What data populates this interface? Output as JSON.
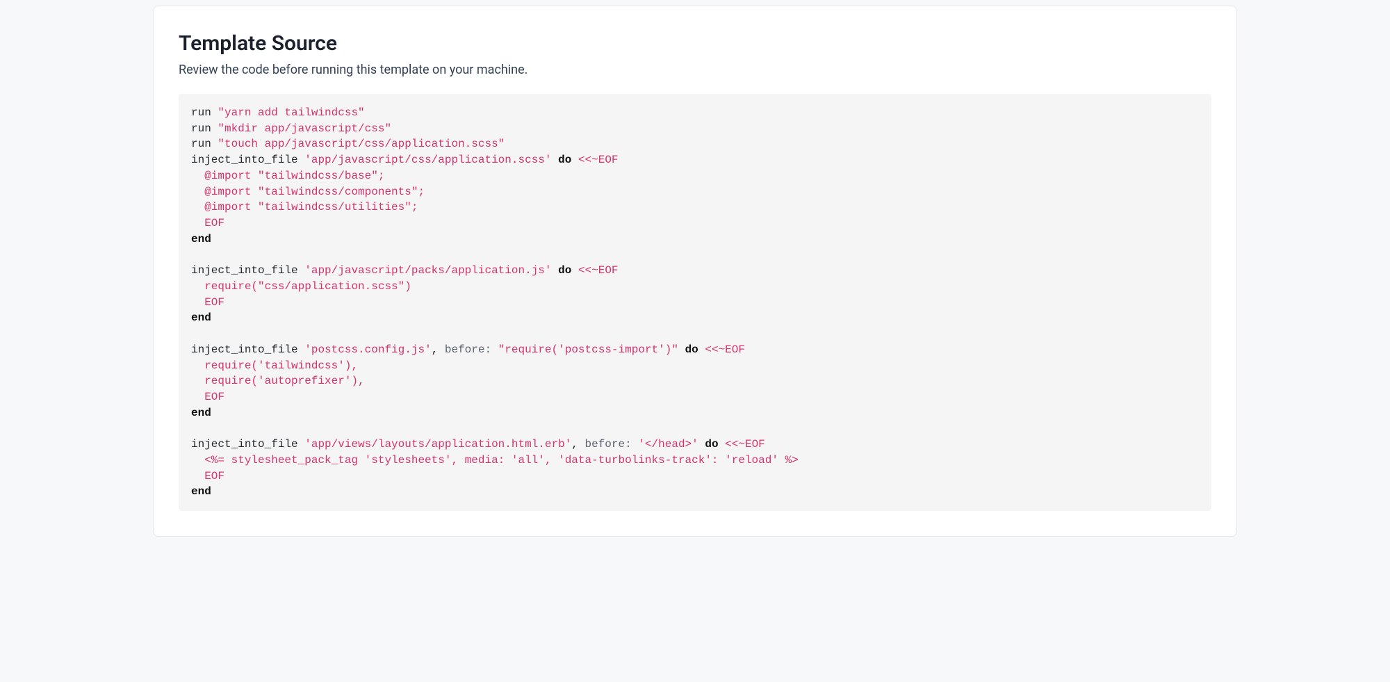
{
  "header": {
    "title": "Template Source",
    "subtitle": "Review the code before running this template on your machine."
  },
  "code": {
    "tokens": [
      [
        [
          "ident",
          "run "
        ],
        [
          "str",
          "\"yarn add tailwindcss\""
        ]
      ],
      [
        [
          "ident",
          "run "
        ],
        [
          "str",
          "\"mkdir app/javascript/css\""
        ]
      ],
      [
        [
          "ident",
          "run "
        ],
        [
          "str",
          "\"touch app/javascript/css/application.scss\""
        ]
      ],
      [
        [
          "ident",
          "inject_into_file "
        ],
        [
          "str",
          "'app/javascript/css/application.scss'"
        ],
        [
          "ident",
          " "
        ],
        [
          "kw",
          "do"
        ],
        [
          "ident",
          " "
        ],
        [
          "str",
          "<<~EOF"
        ]
      ],
      [
        [
          "str",
          "  @import \"tailwindcss/base\";"
        ]
      ],
      [
        [
          "str",
          "  @import \"tailwindcss/components\";"
        ]
      ],
      [
        [
          "str",
          "  @import \"tailwindcss/utilities\";"
        ]
      ],
      [
        [
          "str",
          "  EOF"
        ]
      ],
      [
        [
          "kw",
          "end"
        ]
      ],
      [],
      [
        [
          "ident",
          "inject_into_file "
        ],
        [
          "str",
          "'app/javascript/packs/application.js'"
        ],
        [
          "ident",
          " "
        ],
        [
          "kw",
          "do"
        ],
        [
          "ident",
          " "
        ],
        [
          "str",
          "<<~EOF"
        ]
      ],
      [
        [
          "str",
          "  require(\"css/application.scss\")"
        ]
      ],
      [
        [
          "str",
          "  EOF"
        ]
      ],
      [
        [
          "kw",
          "end"
        ]
      ],
      [],
      [
        [
          "ident",
          "inject_into_file "
        ],
        [
          "str",
          "'postcss.config.js'"
        ],
        [
          "ident",
          ", "
        ],
        [
          "sym",
          "before:"
        ],
        [
          "ident",
          " "
        ],
        [
          "str",
          "\"require('postcss-import')\""
        ],
        [
          "ident",
          " "
        ],
        [
          "kw",
          "do"
        ],
        [
          "ident",
          " "
        ],
        [
          "str",
          "<<~EOF"
        ]
      ],
      [
        [
          "str",
          "  require('tailwindcss'),"
        ]
      ],
      [
        [
          "str",
          "  require('autoprefixer'),"
        ]
      ],
      [
        [
          "str",
          "  EOF"
        ]
      ],
      [
        [
          "kw",
          "end"
        ]
      ],
      [],
      [
        [
          "ident",
          "inject_into_file "
        ],
        [
          "str",
          "'app/views/layouts/application.html.erb'"
        ],
        [
          "ident",
          ", "
        ],
        [
          "sym",
          "before:"
        ],
        [
          "ident",
          " "
        ],
        [
          "str",
          "'</head>'"
        ],
        [
          "ident",
          " "
        ],
        [
          "kw",
          "do"
        ],
        [
          "ident",
          " "
        ],
        [
          "str",
          "<<~EOF"
        ]
      ],
      [
        [
          "str",
          "  <%= stylesheet_pack_tag 'stylesheets', media: 'all', 'data-turbolinks-track': 'reload' %>"
        ]
      ],
      [
        [
          "str",
          "  EOF"
        ]
      ],
      [
        [
          "kw",
          "end"
        ]
      ]
    ]
  }
}
